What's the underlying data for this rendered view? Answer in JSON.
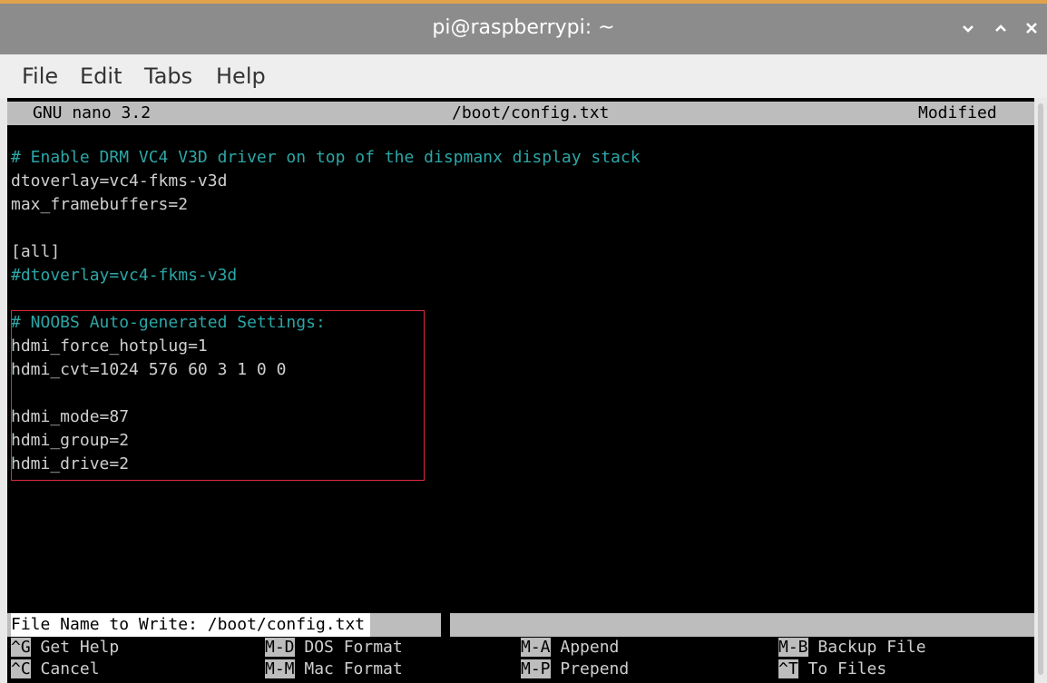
{
  "window": {
    "title": "pi@raspberrypi: ~",
    "accent_color": "#e0a24d"
  },
  "menu": {
    "items": [
      {
        "label": "File"
      },
      {
        "label": "Edit"
      },
      {
        "label": "Tabs"
      },
      {
        "label": "Help"
      }
    ]
  },
  "nano": {
    "version": "GNU nano 3.2",
    "filename": "/boot/config.txt",
    "status": "Modified"
  },
  "editor": {
    "lines": [
      {
        "text": "# Enable DRM VC4 V3D driver on top of the dispmanx display stack",
        "kind": "comment"
      },
      {
        "text": "dtoverlay=vc4-fkms-v3d",
        "kind": "plain"
      },
      {
        "text": "max_framebuffers=2",
        "kind": "plain"
      },
      {
        "text": "",
        "kind": "plain"
      },
      {
        "text": "[all]",
        "kind": "plain"
      },
      {
        "text": "#dtoverlay=vc4-fkms-v3d",
        "kind": "comment"
      },
      {
        "text": "",
        "kind": "plain"
      },
      {
        "text": "# NOOBS Auto-generated Settings:",
        "kind": "comment"
      },
      {
        "text": "hdmi_force_hotplug=1",
        "kind": "plain"
      },
      {
        "text": "hdmi_cvt=1024 576 60 3 1 0 0",
        "kind": "plain"
      },
      {
        "text": "",
        "kind": "plain"
      },
      {
        "text": "hdmi_mode=87",
        "kind": "plain"
      },
      {
        "text": "hdmi_group=2",
        "kind": "plain"
      },
      {
        "text": "hdmi_drive=2",
        "kind": "plain"
      }
    ]
  },
  "prompt": {
    "label": "File Name to Write: /boot/config.txt"
  },
  "shortcuts": [
    {
      "key": "^G",
      "desc": "Get Help"
    },
    {
      "key": "M-D",
      "desc": "DOS Format"
    },
    {
      "key": "M-A",
      "desc": "Append"
    },
    {
      "key": "M-B",
      "desc": "Backup File"
    },
    {
      "key": "^C",
      "desc": "Cancel"
    },
    {
      "key": "M-M",
      "desc": "Mac Format"
    },
    {
      "key": "M-P",
      "desc": "Prepend"
    },
    {
      "key": "^T",
      "desc": "To Files"
    }
  ],
  "colors": {
    "comment": "#2ba6a6",
    "plain": "#cfcfcf",
    "highlight_box": "#e02a3c"
  }
}
